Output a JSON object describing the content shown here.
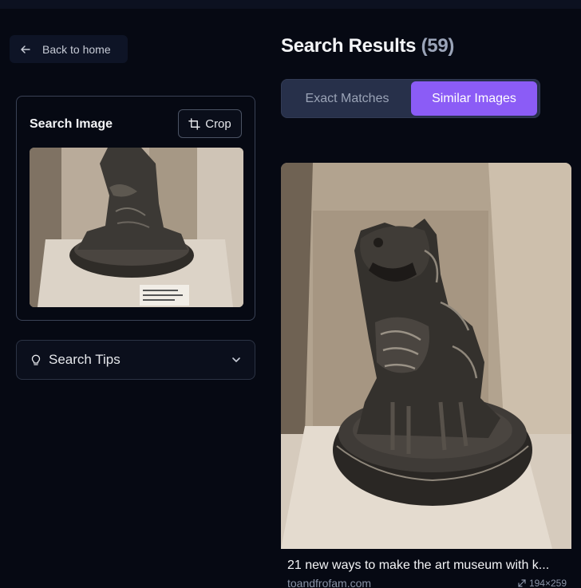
{
  "nav": {
    "back_label": "Back to home"
  },
  "search_card": {
    "title": "Search Image",
    "crop_label": "Crop"
  },
  "tips": {
    "label": "Search Tips"
  },
  "results": {
    "title": "Search Results",
    "count": "(59)"
  },
  "tabs": [
    {
      "label": "Exact Matches",
      "active": false
    },
    {
      "label": "Similar Images",
      "active": true
    }
  ],
  "result_items": [
    {
      "title": "21 new ways to make the art museum with k...",
      "source": "toandfrofam.com",
      "dimensions": "194×259"
    }
  ],
  "colors": {
    "background": "#060913",
    "accent": "#8b5cf6",
    "tab_bg": "#27304a",
    "muted_text": "#8a93a6"
  },
  "icons": {
    "back": "arrow-left-icon",
    "crop": "crop-icon",
    "tips": "lightbulb-icon",
    "expand": "chevron-down-icon",
    "dims": "resize-arrows-icon"
  }
}
